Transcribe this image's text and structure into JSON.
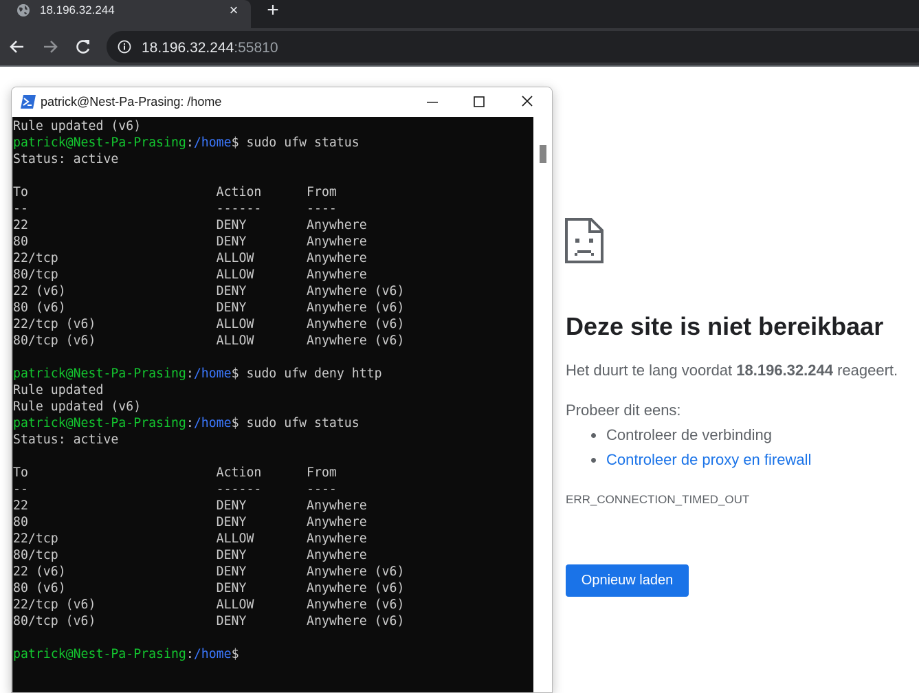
{
  "browser": {
    "tab": {
      "title": "18.196.32.244",
      "close": "×"
    },
    "new_tab": "+",
    "address": {
      "host": "18.196.32.244",
      "port": ":55810"
    }
  },
  "error_page": {
    "title": "Deze site is niet bereikbaar",
    "desc_before": "Het duurt te lang voordat ",
    "desc_host": "18.196.32.244",
    "desc_after": " reageert.",
    "try_heading": "Probeer dit eens:",
    "suggestions": [
      "Controleer de verbinding",
      "Controleer de proxy en firewall"
    ],
    "error_code": "ERR_CONNECTION_TIMED_OUT",
    "reload_label": "Opnieuw laden",
    "colors": {
      "link": "#1a73e8",
      "button": "#1a73e8"
    }
  },
  "terminal": {
    "title": "patrick@Nest-Pa-Prasing: /home",
    "colors": {
      "prompt_user": "#13c72f",
      "prompt_path": "#3b78ff",
      "text": "#cccccc",
      "background": "#0c0c0c"
    },
    "lines": [
      {
        "text": "Rule updated (v6)"
      },
      {
        "prompt": true,
        "user": "patrick@Nest-Pa-Prasing",
        "path": "/home",
        "cmd": "$ sudo ufw status"
      },
      {
        "text": "Status: active"
      },
      {
        "text": ""
      },
      {
        "text": "To                         Action      From"
      },
      {
        "text": "--                         ------      ----"
      },
      {
        "text": "22                         DENY        Anywhere"
      },
      {
        "text": "80                         DENY        Anywhere"
      },
      {
        "text": "22/tcp                     ALLOW       Anywhere"
      },
      {
        "text": "80/tcp                     ALLOW       Anywhere"
      },
      {
        "text": "22 (v6)                    DENY        Anywhere (v6)"
      },
      {
        "text": "80 (v6)                    DENY        Anywhere (v6)"
      },
      {
        "text": "22/tcp (v6)                ALLOW       Anywhere (v6)"
      },
      {
        "text": "80/tcp (v6)                ALLOW       Anywhere (v6)"
      },
      {
        "text": ""
      },
      {
        "prompt": true,
        "user": "patrick@Nest-Pa-Prasing",
        "path": "/home",
        "cmd": "$ sudo ufw deny http"
      },
      {
        "text": "Rule updated"
      },
      {
        "text": "Rule updated (v6)"
      },
      {
        "prompt": true,
        "user": "patrick@Nest-Pa-Prasing",
        "path": "/home",
        "cmd": "$ sudo ufw status"
      },
      {
        "text": "Status: active"
      },
      {
        "text": ""
      },
      {
        "text": "To                         Action      From"
      },
      {
        "text": "--                         ------      ----"
      },
      {
        "text": "22                         DENY        Anywhere"
      },
      {
        "text": "80                         DENY        Anywhere"
      },
      {
        "text": "22/tcp                     ALLOW       Anywhere"
      },
      {
        "text": "80/tcp                     DENY        Anywhere"
      },
      {
        "text": "22 (v6)                    DENY        Anywhere (v6)"
      },
      {
        "text": "80 (v6)                    DENY        Anywhere (v6)"
      },
      {
        "text": "22/tcp (v6)                ALLOW       Anywhere (v6)"
      },
      {
        "text": "80/tcp (v6)                DENY        Anywhere (v6)"
      },
      {
        "text": ""
      },
      {
        "prompt": true,
        "user": "patrick@Nest-Pa-Prasing",
        "path": "/home",
        "cmd": "$"
      }
    ]
  }
}
